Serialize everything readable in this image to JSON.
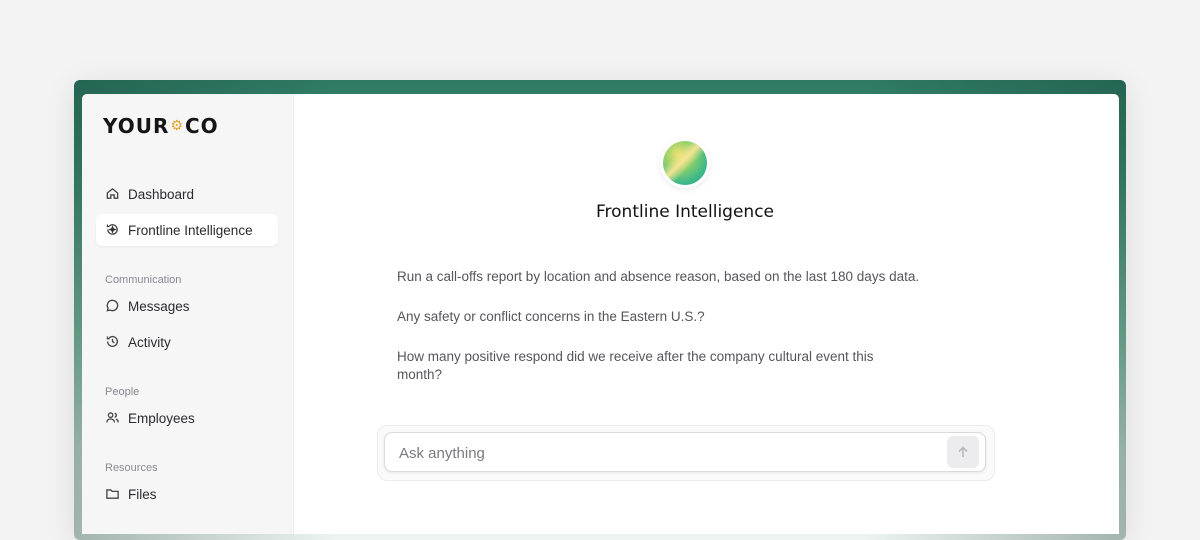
{
  "logo": {
    "left": "YOUR",
    "right": "CO",
    "mark": "⚙"
  },
  "sidebar": {
    "items": [
      {
        "label": "Dashboard",
        "icon": "home-icon"
      },
      {
        "label": "Frontline Intelligence",
        "icon": "sparkle-icon",
        "active": true
      }
    ],
    "sections": [
      {
        "title": "Communication",
        "items": [
          {
            "label": "Messages",
            "icon": "chat-icon"
          },
          {
            "label": "Activity",
            "icon": "history-icon"
          }
        ]
      },
      {
        "title": "People",
        "items": [
          {
            "label": "Employees",
            "icon": "users-icon"
          }
        ]
      },
      {
        "title": "Resources",
        "items": [
          {
            "label": "Files",
            "icon": "folder-icon"
          }
        ]
      }
    ]
  },
  "main": {
    "title": "Frontline Intelligence",
    "suggestions": [
      "Run a call-offs report by location and absence reason, based on the last 180 days data.",
      "Any safety or conflict concerns in the Eastern U.S.?",
      "How many positive respond did we receive after the company cultural event this month?"
    ],
    "input": {
      "placeholder": "Ask anything"
    }
  },
  "colors": {
    "accent": "#2e7a64",
    "logo_mark": "#e8a12a"
  }
}
